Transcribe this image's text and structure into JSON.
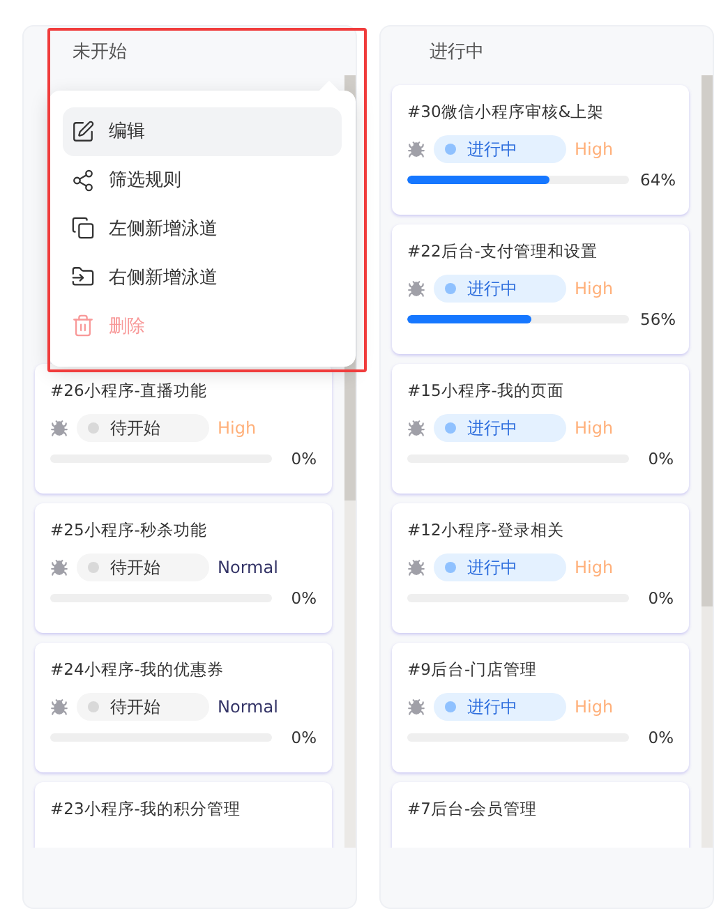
{
  "columns": [
    {
      "title": "未开始",
      "menu": {
        "items": [
          {
            "label": "编辑",
            "kind": "edit",
            "selected": true
          },
          {
            "label": "筛选规则",
            "kind": "share",
            "selected": false
          },
          {
            "label": "左侧新增泳道",
            "kind": "copy",
            "selected": false
          },
          {
            "label": "右侧新增泳道",
            "kind": "folder",
            "selected": false
          },
          {
            "label": "删除",
            "kind": "delete",
            "selected": false
          }
        ]
      },
      "cards": [
        {
          "title": "#26小程序-直播功能",
          "status": {
            "label": "待开始",
            "kind": "todo"
          },
          "priority": {
            "label": "High",
            "kind": "high"
          },
          "level": 0,
          "percent": "0%"
        },
        {
          "title": "#25小程序-秒杀功能",
          "status": {
            "label": "待开始",
            "kind": "todo"
          },
          "priority": {
            "label": "Normal",
            "kind": "normal"
          },
          "level": 0,
          "percent": "0%"
        },
        {
          "title": "#24小程序-我的优惠券",
          "status": {
            "label": "待开始",
            "kind": "todo"
          },
          "priority": {
            "label": "Normal",
            "kind": "normal"
          },
          "level": 0,
          "percent": "0%"
        },
        {
          "title": "#23小程序-我的积分管理"
        }
      ]
    },
    {
      "title": "进行中",
      "cards": [
        {
          "title": "#30微信小程序审核&上架",
          "status": {
            "label": "进行中",
            "kind": "doing"
          },
          "priority": {
            "label": "High",
            "kind": "high"
          },
          "level": 0.64,
          "percent": "64%"
        },
        {
          "title": "#22后台-支付管理和设置",
          "status": {
            "label": "进行中",
            "kind": "doing"
          },
          "priority": {
            "label": "High",
            "kind": "high"
          },
          "level": 0.56,
          "percent": "56%"
        },
        {
          "title": "#15小程序-我的页面",
          "status": {
            "label": "进行中",
            "kind": "doing"
          },
          "priority": {
            "label": "High",
            "kind": "high"
          },
          "level": 0,
          "percent": "0%"
        },
        {
          "title": "#12小程序-登录相关",
          "status": {
            "label": "进行中",
            "kind": "doing"
          },
          "priority": {
            "label": "High",
            "kind": "high"
          },
          "level": 0,
          "percent": "0%"
        },
        {
          "title": "#9后台-门店管理",
          "status": {
            "label": "进行中",
            "kind": "doing"
          },
          "priority": {
            "label": "High",
            "kind": "high"
          },
          "level": 0,
          "percent": "0%"
        },
        {
          "title": "#7后台-会员管理"
        }
      ]
    }
  ]
}
